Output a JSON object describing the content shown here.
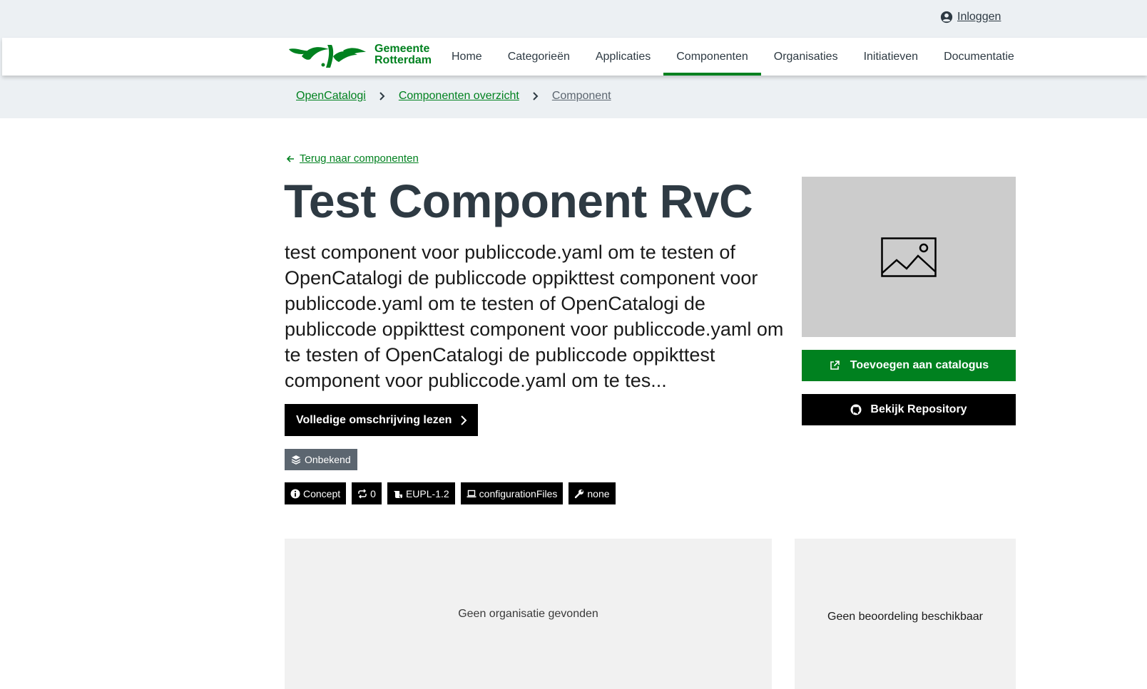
{
  "header": {
    "login_label": "Inloggen",
    "logo_line1": "Gemeente",
    "logo_line2": "Rotterdam",
    "nav": [
      {
        "label": "Home",
        "active": false
      },
      {
        "label": "Categorieën",
        "active": false
      },
      {
        "label": "Applicaties",
        "active": false
      },
      {
        "label": "Componenten",
        "active": true
      },
      {
        "label": "Organisaties",
        "active": false
      },
      {
        "label": "Initiatieven",
        "active": false
      },
      {
        "label": "Documentatie",
        "active": false
      }
    ]
  },
  "breadcrumb": [
    "OpenCatalogi",
    "Componenten overzicht",
    "Component"
  ],
  "main": {
    "back_label": "Terug naar componenten",
    "title": "Test Component RvC",
    "description": "test component voor publiccode.yaml om te testen of OpenCatalogi de publiccode oppikttest component voor publiccode.yaml om te testen of OpenCatalogi de publiccode oppikttest component voor publiccode.yaml om te testen of OpenCatalogi de publiccode oppikttest component voor publiccode.yaml om te tes...",
    "read_more_label": "Volledige omschrijving lezen",
    "layer_badge": "Onbekend",
    "badges": {
      "status": "Concept",
      "forks": "0",
      "license": "EUPL-1.2",
      "platform": "configurationFiles",
      "maintenance": "none"
    }
  },
  "sidebar": {
    "add_to_catalog_label": "Toevoegen aan catalogus",
    "view_repo_label": "Bekijk Repository"
  },
  "cards": {
    "organization_empty": "Geen organisatie gevonden",
    "rating_empty": "Geen beoordeling beschikbaar"
  },
  "colors": {
    "brand_green": "#00811f",
    "topbar_bg": "#ecf0f3",
    "heading": "#2e3a43"
  }
}
